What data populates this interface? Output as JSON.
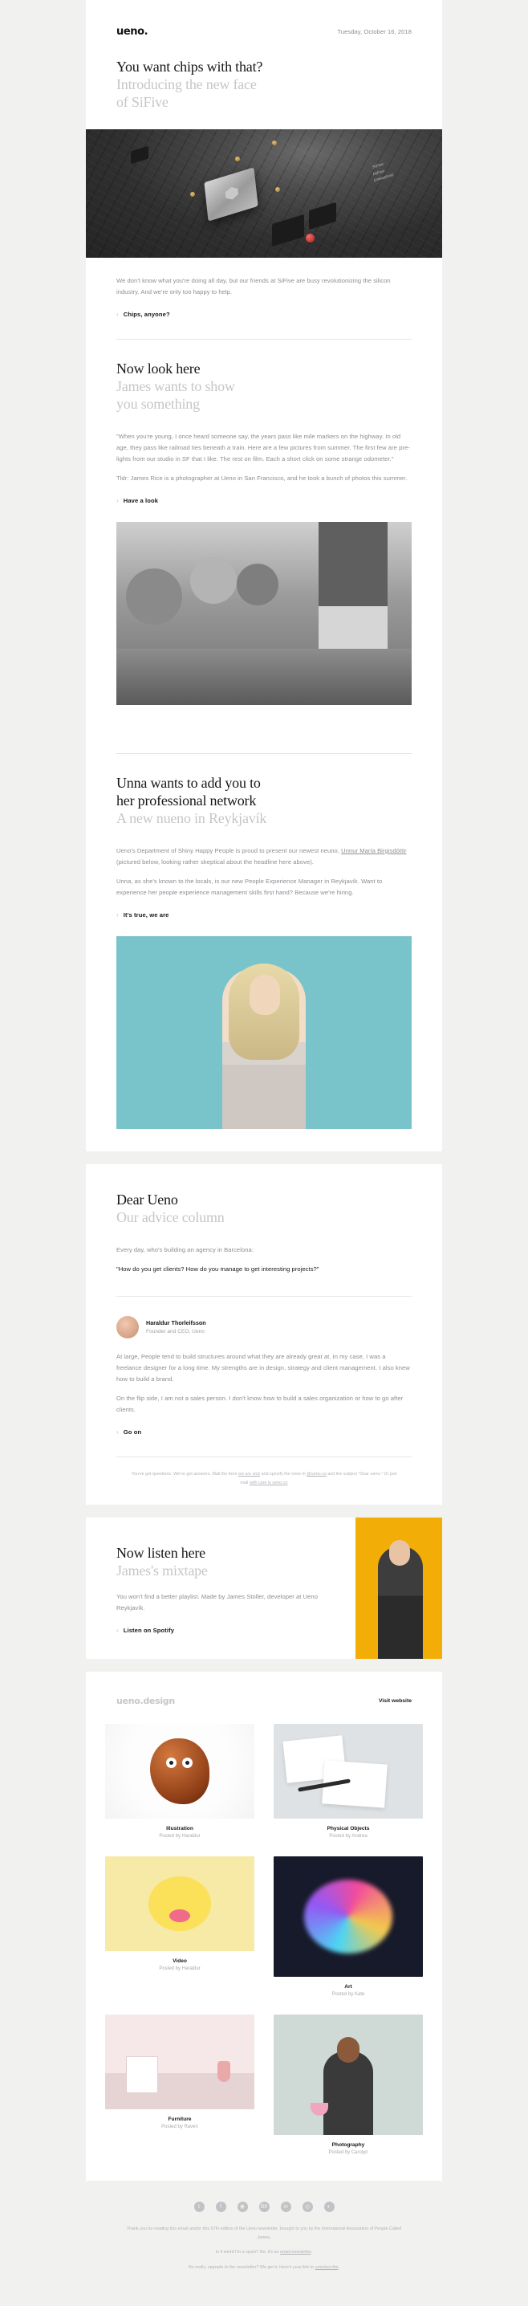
{
  "header": {
    "logo": "ueno.",
    "date": "Tuesday, October 16, 2018"
  },
  "sections": {
    "chips": {
      "headline": "You want chips with that?",
      "subline_1": "Introducing the new face",
      "subline_2": "of SiFive",
      "body": "We don't know what you're doing all day, but our friends at SiFive are busy revolutionizing the silicon industry. And we're only too happy to help.",
      "cta": "Chips, anyone?",
      "chevron": "›",
      "image_alt": "sifive-circuit-board-photo",
      "image_badge_1": "SiFive",
      "image_badge_2": "HiFive",
      "image_badge_3": "Unleashed"
    },
    "look": {
      "headline": "Now look here",
      "subline_1": "James wants to show",
      "subline_2": "you something",
      "body_1": "\"When you're young, I once heard someone say, the years pass like mile markers on the highway. In old age, they pass like railroad ties beneath a train. Here are a few pictures from summer. The first few are pre-lights from our studio in SF that I like. The rest on film. Each a short click on some strange odometer.\"",
      "body_2": "Tldr: James Rice is a photographer at Ueno in San Francisco, and he took a bunch of photos this summer.",
      "cta": "Have a look",
      "chevron": "›",
      "image_alt": "black-and-white-summer-photo"
    },
    "unna": {
      "headline_1": "Unna wants to add you to",
      "headline_2": "her professional network",
      "subline": "A new nueno in Reykjavík",
      "body_1_pre": "Ueno's Department of Shiny Happy People is proud to present our newest neuno, ",
      "body_1_link": "Unnur María Birgisdóttir",
      "body_1_post": " (pictured below, looking rather skeptical about the headline here above).",
      "body_2": "Unna, as she's known to the locals, is our new People Experience Manager in Reykjavík. Want to experience her people experience management skills first hand? Because we're hiring.",
      "cta": "It's true, we are",
      "chevron": "›",
      "image_alt": "unna-portrait-teal-background"
    },
    "advice": {
      "headline": "Dear Ueno",
      "subline": "Our advice column",
      "intro": "Every day, who's building an agency in Barcelona:",
      "question": "\"How do you get clients? How do you manage to get interesting projects?\"",
      "author_name": "Haraldur Thorleifsson",
      "author_role": "Founder and CEO, Ueno",
      "answer_1": "At large, People tend to build structures around what they are already great at. In my case, I was a freelance designer for a long time. My strengths are in design, strategy and client management. I also knew how to build a brand.",
      "answer_2": "On the flip side, I am not a sales person. I don't know how to build a sales organization or how to go after clients.",
      "cta": "Go on",
      "chevron": "›",
      "legal_1": "You've got questions. We've got answers. Mail the form ",
      "legal_link_1": "we are sick",
      "legal_2": " and specify the ones in ",
      "legal_link_2": "@ueno.co",
      "legal_3": " and the subject \"Dear ueno.\" Or just mail ",
      "legal_link_3": "with care is ueno.co"
    },
    "mixtape": {
      "headline": "Now listen here",
      "subline": "James's mixtape",
      "body": "You won't find a better playlist. Made by James Stoller, developer at Ueno Reykjavík.",
      "cta": "Listen on Spotify",
      "chevron": "›",
      "image_alt": "yellow-background-portrait"
    },
    "portfolio": {
      "logo_main": "ueno.",
      "logo_accent": "design",
      "visit_label": "Visit website",
      "items": [
        {
          "title": "Illustration",
          "by": "Posted by Haraldur",
          "thumb": "illustration-bean-character",
          "tall": false
        },
        {
          "title": "Physical Objects",
          "by": "Posted by Andrea",
          "thumb": "physical-objects-paper-stack",
          "tall": false
        },
        {
          "title": "Video",
          "by": "Posted by Haraldur",
          "thumb": "video-yellow-face",
          "tall": false
        },
        {
          "title": "Art",
          "by": "Posted by Kate",
          "thumb": "art-colorful-swirl",
          "tall": true
        },
        {
          "title": "Furniture",
          "by": "Posted by Raven",
          "thumb": "furniture-pink-room",
          "tall": false
        },
        {
          "title": "Photography",
          "by": "Posted by Carolyn",
          "thumb": "photography-woman-portrait",
          "tall": true
        }
      ]
    }
  },
  "footer": {
    "socials": [
      {
        "name": "twitter-icon",
        "glyph": "t"
      },
      {
        "name": "facebook-icon",
        "glyph": "f"
      },
      {
        "name": "dribbble-icon",
        "glyph": "◉"
      },
      {
        "name": "behance-icon",
        "glyph": "Bē"
      },
      {
        "name": "linkedin-icon",
        "glyph": "in"
      },
      {
        "name": "instagram-icon",
        "glyph": "◎"
      },
      {
        "name": "github-icon",
        "glyph": "◐"
      }
    ],
    "line_1_pre": "Thank you for reading this email and/or this 57th edition of the Ueno newsletter, brought to you by the International Association of People Called James.",
    "line_2_pre": "Is it weird I'm a spam? No, it's an ",
    "line_2_link": "email newsletter",
    "line_2_post": ".",
    "line_3_pre": "No really, upgrade to the newsletter? We get it. Here's your link to ",
    "line_3_link": "unsubscribe",
    "line_3_post": "."
  }
}
